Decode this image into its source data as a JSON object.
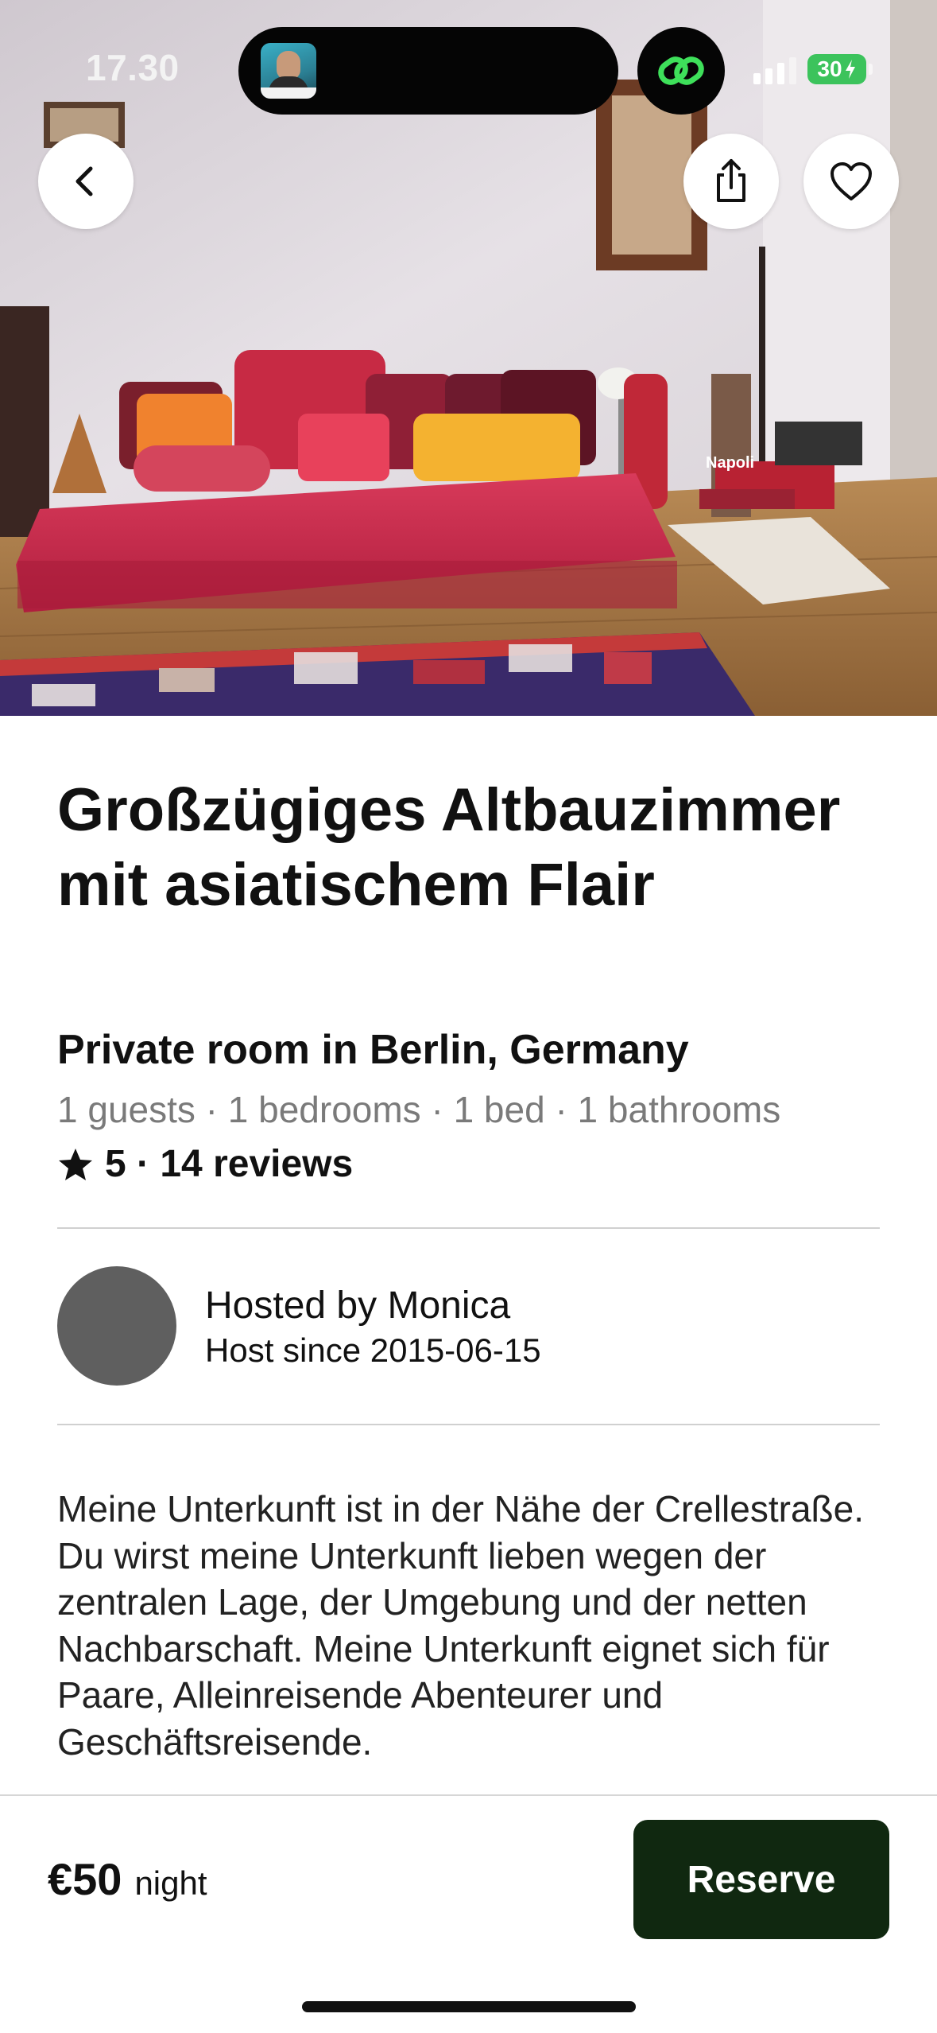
{
  "status_bar": {
    "time": "17.30",
    "battery": "30"
  },
  "hero": {
    "photo": "room-photo",
    "wall_sign": "Napoli"
  },
  "header_buttons": {
    "back": "chevron-left-icon",
    "share": "share-icon",
    "favorite": "heart-icon"
  },
  "listing": {
    "title": "Großzügiges Altbauzimmer mit asiatischem Flair",
    "subtitle": "Private room in Berlin, Germany",
    "details": "1 guests · 1 bedrooms · 1 bed · 1 bathrooms",
    "rating_text": "5 · 14 reviews"
  },
  "host": {
    "name": "Hosted by Monica",
    "since": "Host since 2015-06-15"
  },
  "description": "Meine Unterkunft ist in der Nähe der Crellestraße. Du wirst meine Unterkunft lieben wegen der zentralen Lage, der Umgebung und der netten Nachbarschaft. Meine Unterkunft eignet sich für Paare, Alleinreisende Abenteurer und Geschäftsreisende.",
  "footer": {
    "price": "€50",
    "price_unit": "night",
    "reserve_label": "Reserve"
  },
  "colors": {
    "accent": "#102810",
    "battery": "#3cc35c",
    "muted_text": "#7a7a7a"
  }
}
